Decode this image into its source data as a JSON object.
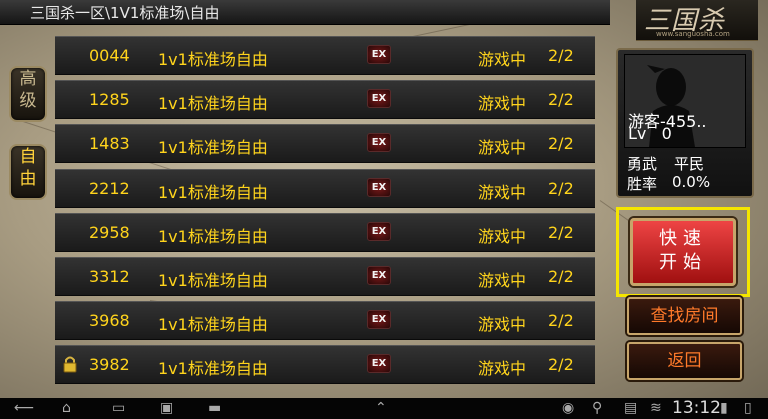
{
  "title": "三国杀一区\\1V1标准场\\自由",
  "logo": {
    "mark": "三国杀",
    "url": "www.sanguosha.com"
  },
  "tabs": [
    {
      "label_top": "高",
      "label_bottom": "级"
    },
    {
      "label_top": "自",
      "label_bottom": "由"
    }
  ],
  "rooms": [
    {
      "id": "0044",
      "name": "1v1标准场自由",
      "badge": "EX",
      "status": "游戏中",
      "count": "2/2",
      "locked": false
    },
    {
      "id": "1285",
      "name": "1v1标准场自由",
      "badge": "EX",
      "status": "游戏中",
      "count": "2/2",
      "locked": false
    },
    {
      "id": "1483",
      "name": "1v1标准场自由",
      "badge": "EX",
      "status": "游戏中",
      "count": "2/2",
      "locked": false
    },
    {
      "id": "2212",
      "name": "1v1标准场自由",
      "badge": "EX",
      "status": "游戏中",
      "count": "2/2",
      "locked": false
    },
    {
      "id": "2958",
      "name": "1v1标准场自由",
      "badge": "EX",
      "status": "游戏中",
      "count": "2/2",
      "locked": false
    },
    {
      "id": "3312",
      "name": "1v1标准场自由",
      "badge": "EX",
      "status": "游戏中",
      "count": "2/2",
      "locked": false
    },
    {
      "id": "3968",
      "name": "1v1标准场自由",
      "badge": "EX",
      "status": "游戏中",
      "count": "2/2",
      "locked": false
    },
    {
      "id": "3982",
      "name": "1v1标准场自由",
      "badge": "EX",
      "status": "游戏中",
      "count": "2/2",
      "locked": true
    }
  ],
  "profile": {
    "name": "游客-455..",
    "level_label": "Lv",
    "level": "0",
    "title_label": "勇武",
    "title_value": "平民",
    "winrate_label": "胜率",
    "winrate_value": "0.0%"
  },
  "buttons": {
    "quick_top": "快速",
    "quick_bottom": "开始",
    "find_room": "查找房间",
    "back": "返回"
  },
  "system_bar": {
    "time": "13:12"
  },
  "colors": {
    "room_text": "#ffd41c",
    "highlight": "#f5e600",
    "quick_button": "#d02020"
  }
}
